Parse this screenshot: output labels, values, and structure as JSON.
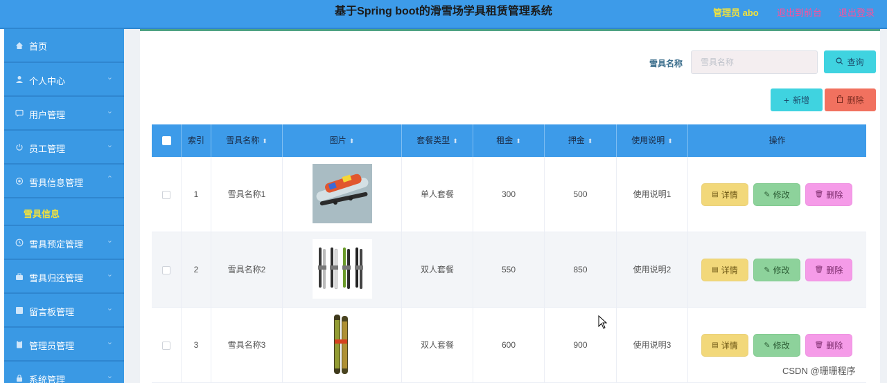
{
  "header": {
    "title": "基于Spring boot的滑雪场学具租赁管理系统",
    "admin": "管理员 abo",
    "link_front": "退出到前台",
    "link_logout": "退出登录"
  },
  "sidebar": {
    "items": [
      {
        "label": "首页",
        "icon": "home-icon",
        "arrow": false
      },
      {
        "label": "个人中心",
        "icon": "user-icon",
        "arrow": true
      },
      {
        "label": "用户管理",
        "icon": "chat-icon",
        "arrow": true
      },
      {
        "label": "员工管理",
        "icon": "power-icon",
        "arrow": true
      },
      {
        "label": "雪具信息管理",
        "icon": "settings-icon",
        "arrow": true,
        "expanded": true
      },
      {
        "label": "雪具预定管理",
        "icon": "clock-icon",
        "arrow": true
      },
      {
        "label": "雪具归还管理",
        "icon": "briefcase-icon",
        "arrow": true
      },
      {
        "label": "留言板管理",
        "icon": "board-icon",
        "arrow": true
      },
      {
        "label": "管理员管理",
        "icon": "clipboard-icon",
        "arrow": true
      },
      {
        "label": "系统管理",
        "icon": "lock-icon",
        "arrow": true
      }
    ],
    "subitem": "雪具信息"
  },
  "search": {
    "label": "雪具名称",
    "placeholder": "雪具名称",
    "query_label": "查询"
  },
  "toolbar": {
    "add_label": "新增",
    "delete_label": "删除"
  },
  "table": {
    "headers": [
      "索引",
      "雪具名称",
      "图片",
      "套餐类型",
      "租金",
      "押金",
      "使用说明",
      "操作"
    ],
    "rows": [
      {
        "index": "1",
        "name": "雪具名称1",
        "package": "单人套餐",
        "rent": "300",
        "deposit": "500",
        "note": "使用说明1"
      },
      {
        "index": "2",
        "name": "雪具名称2",
        "package": "双人套餐",
        "rent": "550",
        "deposit": "850",
        "note": "使用说明2"
      },
      {
        "index": "3",
        "name": "雪具名称3",
        "package": "双人套餐",
        "rent": "600",
        "deposit": "900",
        "note": "使用说明3"
      }
    ],
    "actions": {
      "detail": "详情",
      "edit": "修改",
      "remove": "删除"
    }
  },
  "watermark": "CSDN @珊珊程序",
  "colors": {
    "header_bg": "#3d9be9",
    "sidebar_bg": "#3a99e4",
    "accent_yellow": "#f3e23c",
    "link_pink": "#ff4f9a"
  }
}
